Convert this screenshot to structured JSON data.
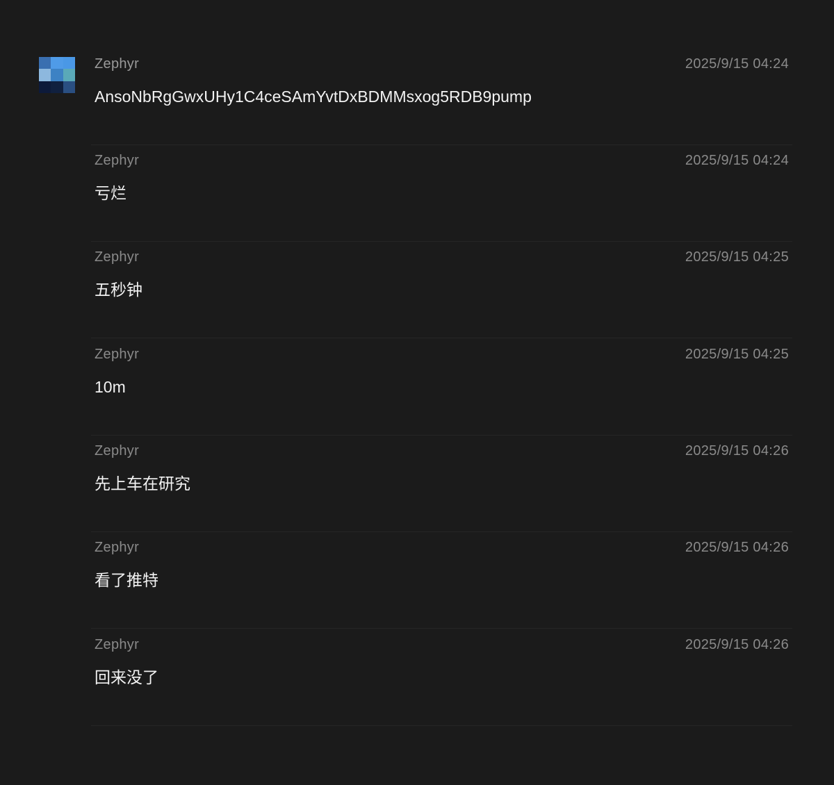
{
  "avatar": {
    "colors": [
      "#3a6fb0",
      "#4f9be8",
      "#4a98e6",
      "#8db8de",
      "#3d82c4",
      "#5aa9b8",
      "#0d1a3a",
      "#10203f",
      "#2a4f82"
    ]
  },
  "messages": [
    {
      "sender": "Zephyr",
      "time": "2025/9/15 04:24",
      "text": "AnsoNbRgGwxUHy1C4ceSAmYvtDxBDMMsxog5RDB9pump"
    },
    {
      "sender": "Zephyr",
      "time": "2025/9/15 04:24",
      "text": "亏烂"
    },
    {
      "sender": "Zephyr",
      "time": "2025/9/15 04:25",
      "text": "五秒钟"
    },
    {
      "sender": "Zephyr",
      "time": "2025/9/15 04:25",
      "text": "10m"
    },
    {
      "sender": "Zephyr",
      "time": "2025/9/15 04:26",
      "text": "先上车在研究"
    },
    {
      "sender": "Zephyr",
      "time": "2025/9/15 04:26",
      "text": "看了推特"
    },
    {
      "sender": "Zephyr",
      "time": "2025/9/15 04:26",
      "text": "回来没了"
    }
  ]
}
